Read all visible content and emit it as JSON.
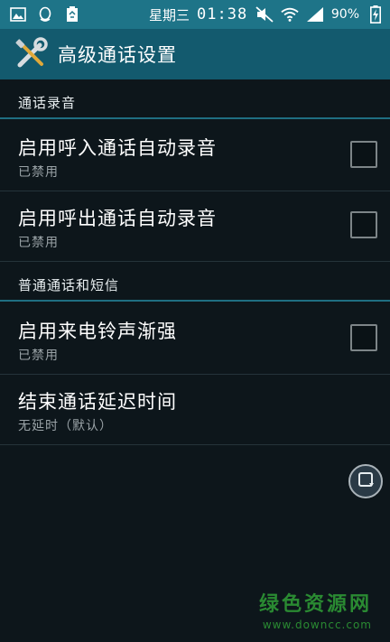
{
  "status_bar": {
    "weekday": "星期三",
    "time": "01:38",
    "battery_percent": "90%",
    "icons": [
      "image-icon",
      "qq-icon",
      "recycle-icon",
      "mute-icon",
      "wifi-icon",
      "signal-icon",
      "battery-charging-icon"
    ]
  },
  "app_bar": {
    "icon": "tools-icon",
    "title": "高级通话设置"
  },
  "sections": [
    {
      "header": "通话录音",
      "items": [
        {
          "title": "启用呼入通话自动录音",
          "summary": "已禁用",
          "checked": false
        },
        {
          "title": "启用呼出通话自动录音",
          "summary": "已禁用",
          "checked": false
        }
      ]
    },
    {
      "header": "普通通话和短信",
      "items": [
        {
          "title": "启用来电铃声渐强",
          "summary": "已禁用",
          "checked": false
        },
        {
          "title": "结束通话延迟时间",
          "summary": "无延时（默认）"
        }
      ]
    }
  ],
  "floating_button": {
    "icon": "rotate-screen-icon"
  },
  "watermark": {
    "text": "绿色资源网",
    "url": "www.downcc.com"
  },
  "colors": {
    "status_bar": "#1e7488",
    "app_bar": "#135a6e",
    "background": "#0d161b",
    "divider_accent": "#1f6f82",
    "watermark": "#2a8a32"
  }
}
